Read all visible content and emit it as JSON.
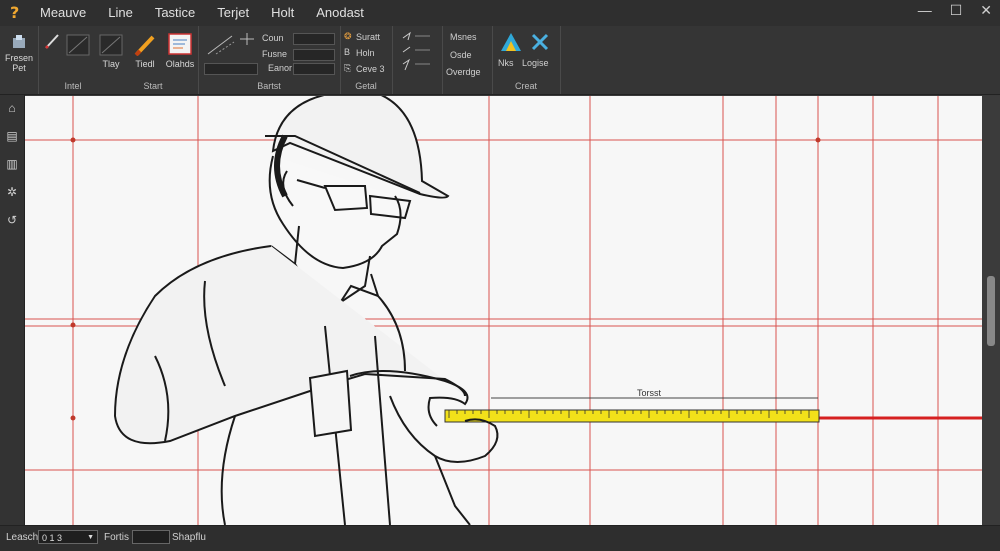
{
  "menu": {
    "app_icon": "?",
    "items": [
      "Meauve",
      "Line",
      "Tastice",
      "Terjet",
      "Holt",
      "Anodast"
    ]
  },
  "window": {
    "minimize": "—",
    "maximize": "☐",
    "close": "✕"
  },
  "ribbon": {
    "group1": {
      "tool1": "Fresen Pet",
      "label": ""
    },
    "group2": {
      "tool1": "Tlay",
      "tool2": "Tiedl",
      "tool3": "Olahds",
      "label_left": "Intel",
      "label_right": "Start"
    },
    "group3": {
      "dd1": "Coun",
      "dd2": "Fusne",
      "dd3": "Eanor",
      "label": "Bartst"
    },
    "group4": {
      "t1": "Suratt",
      "t2": "Holn",
      "t3": "Ceve 3",
      "label": "Getal"
    },
    "group5": {
      "t1": "Msnes",
      "t2": "Osde",
      "t3": "Overdge",
      "label": ""
    },
    "group6": {
      "t1": "Nks",
      "t2": "Logise",
      "label": "Creat"
    }
  },
  "canvas": {
    "dimension_label": "Torsst"
  },
  "status": {
    "length_label": "Leasch",
    "length_value": "0 1 3",
    "form_label": "Fortis",
    "form_value": "",
    "extra_label": "Shapflu"
  },
  "colors": {
    "grid_line": "#d9534f",
    "tape": "#f2e11a",
    "measure_line": "#d62020",
    "brand_icon": "#f0a830"
  },
  "icons": [
    "app-icon",
    "minimize-icon",
    "maximize-icon",
    "close-icon",
    "move-icon",
    "pencil-icon",
    "brush-icon",
    "picture-icon",
    "line-icon",
    "font-icon",
    "triangle-icon",
    "cross-icon",
    "home-icon",
    "layers-icon",
    "stack-icon",
    "gear-icon",
    "swirl-icon"
  ]
}
